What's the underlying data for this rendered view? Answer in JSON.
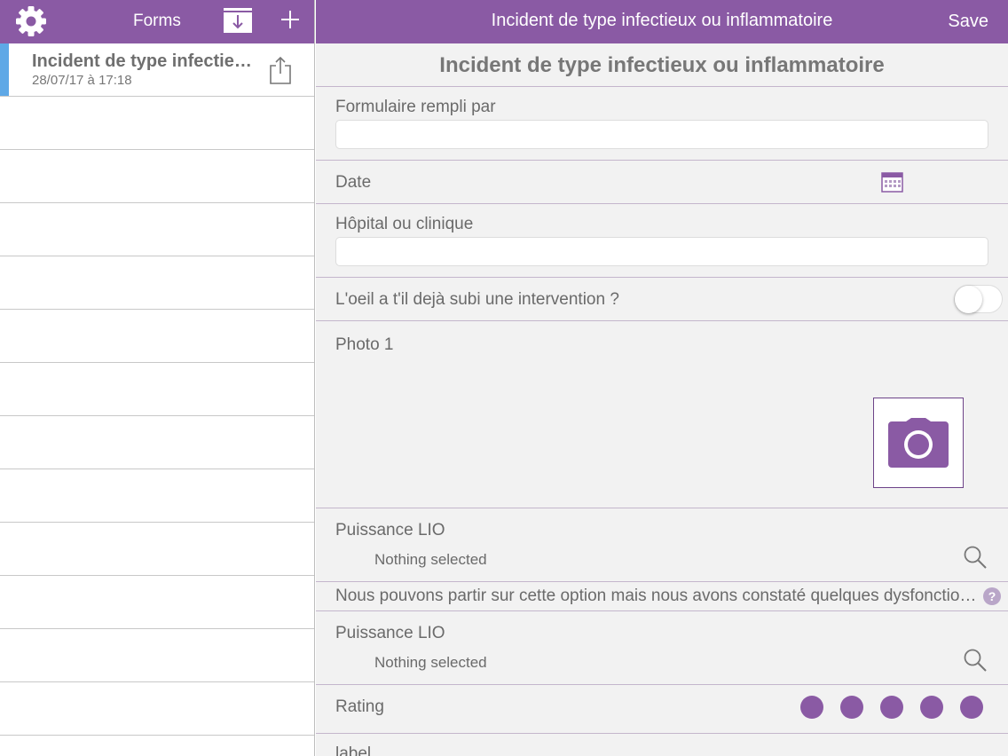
{
  "left_panel": {
    "title": "Forms",
    "icons": [
      "gear-icon",
      "inbox-download-icon",
      "plus-icon"
    ],
    "forms": [
      {
        "name": "Incident de type infectie…",
        "date": "28/07/17 à 17:18",
        "icon": "share-icon"
      }
    ]
  },
  "right_panel": {
    "title": "Incident de type infectieux ou inflammatoire",
    "save_label": "Save",
    "form_heading": "Incident de type infectieux ou inflammatoire",
    "fields": {
      "filled_by": {
        "label": "Formulaire rempli par",
        "value": ""
      },
      "date": {
        "label": "Date",
        "icon": "calendar-icon"
      },
      "hospital": {
        "label": "Hôpital ou clinique",
        "value": ""
      },
      "eye_intervention": {
        "label": "L'oeil a t'il dejà subi une intervention ?",
        "checked": false
      },
      "photo": {
        "label": "Photo 1",
        "icon": "camera-icon"
      },
      "puissance_1": {
        "label": "Puissance LIO",
        "value": "Nothing selected",
        "icon": "search-icon"
      },
      "note": {
        "text": "Nous pouvons partir sur cette option mais nous avons constaté quelques dysfonctio…",
        "help": "?"
      },
      "puissance_2": {
        "label": "Puissance LIO",
        "value": "Nothing selected",
        "icon": "search-icon"
      },
      "rating": {
        "label": "Rating",
        "max": 5,
        "value": 0
      },
      "last": {
        "label": "label"
      }
    }
  },
  "colors": {
    "accent": "#8a5aa4",
    "selection": "#5ea8e6",
    "panel_bg": "#f2f2f2"
  }
}
